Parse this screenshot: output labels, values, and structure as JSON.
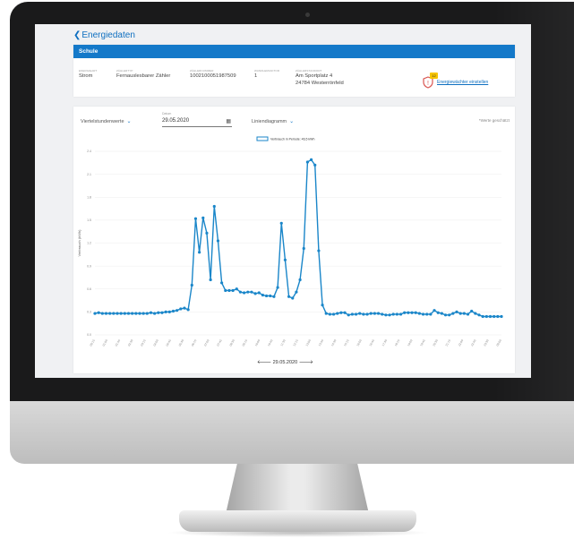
{
  "nav": {
    "back_label": "Energiedaten"
  },
  "location": {
    "name": "Schule"
  },
  "meter": {
    "fields": [
      {
        "label": "Energieart",
        "value": "Strom"
      },
      {
        "label": "Zählertyp",
        "value": "Fernauslesbarer Zähler"
      },
      {
        "label": "Zählernummer",
        "value": "1002100051987509"
      },
      {
        "label": "Wandlerfaktor",
        "value": "1"
      },
      {
        "label": "Zählerstandort",
        "value": "Am Sportplatz 4",
        "value2": "24784 Westerrönfeld"
      }
    ],
    "badge_count": "12",
    "alert_link": "Energiewächter einstellen"
  },
  "controls": {
    "granularity": "Viertelstundenwerte",
    "date_label": "Datum",
    "date_value": "29.05.2020",
    "chart_kind": "Liniendiagramm",
    "hint": "*Werte geschätzt"
  },
  "pager": {
    "date": "29.05.2020"
  },
  "icons": {
    "back": "chevron-left-icon",
    "dropdown": "chevron-down-icon",
    "calendar": "calendar-icon",
    "warning": "shield-warning-icon",
    "prev": "arrow-left-icon",
    "next": "arrow-right-icon"
  },
  "colors": {
    "accent": "#1479c9",
    "line": "#1a86c9",
    "badge": "#f6c400",
    "warning": "#d9534f"
  },
  "chart_data": {
    "type": "line",
    "legend": [
      "Verbrauch in Periode: 46,5 kWh"
    ],
    "ylabel": "Verbrauch (kWh)",
    "ylim": [
      0,
      2.4
    ],
    "yticks": [
      "0.0",
      "0.3",
      "0.6",
      "0.9",
      "1.2",
      "1.5",
      "1.8",
      "2.1",
      "2.4"
    ],
    "x_tick_labels": [
      "00:15",
      "01:00",
      "01:45",
      "02:30",
      "03:15",
      "04:00",
      "04:45",
      "05:30",
      "06:15",
      "07:00",
      "07:45",
      "08:30",
      "09:15",
      "10:00",
      "10:45",
      "11:30",
      "12:15",
      "13:00",
      "13:45",
      "14:30",
      "15:15",
      "16:00",
      "16:45",
      "17:30",
      "18:15",
      "19:00",
      "19:45",
      "20:30",
      "21:15",
      "22:00",
      "22:45",
      "23:30",
      "00:00"
    ],
    "series": [
      {
        "name": "Verbrauch in Periode: 46,5 kWh",
        "values": [
          0.28,
          0.29,
          0.28,
          0.28,
          0.28,
          0.28,
          0.28,
          0.28,
          0.28,
          0.28,
          0.28,
          0.28,
          0.28,
          0.28,
          0.28,
          0.29,
          0.28,
          0.29,
          0.29,
          0.3,
          0.3,
          0.31,
          0.32,
          0.34,
          0.35,
          0.33,
          0.65,
          1.52,
          1.08,
          1.53,
          1.33,
          0.72,
          1.68,
          1.23,
          0.68,
          0.58,
          0.58,
          0.58,
          0.6,
          0.56,
          0.55,
          0.56,
          0.56,
          0.54,
          0.55,
          0.52,
          0.51,
          0.51,
          0.5,
          0.62,
          1.46,
          0.98,
          0.5,
          0.48,
          0.56,
          0.72,
          1.13,
          2.26,
          2.29,
          2.22,
          1.1,
          0.39,
          0.28,
          0.27,
          0.27,
          0.28,
          0.29,
          0.29,
          0.26,
          0.27,
          0.27,
          0.28,
          0.27,
          0.27,
          0.28,
          0.28,
          0.28,
          0.27,
          0.26,
          0.26,
          0.27,
          0.27,
          0.27,
          0.29,
          0.29,
          0.29,
          0.29,
          0.28,
          0.27,
          0.27,
          0.27,
          0.32,
          0.29,
          0.28,
          0.26,
          0.26,
          0.28,
          0.3,
          0.28,
          0.28,
          0.27,
          0.31,
          0.28,
          0.26,
          0.24,
          0.24,
          0.24,
          0.24,
          0.24,
          0.24
        ]
      }
    ]
  }
}
